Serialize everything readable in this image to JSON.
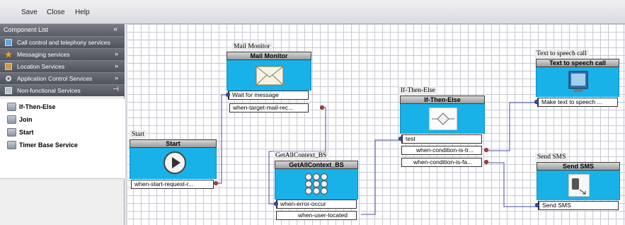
{
  "menu": {
    "save": "Save",
    "close": "Close",
    "help": "Help"
  },
  "sidebar": {
    "header": "Component List",
    "header_chevron": "«",
    "categories": [
      {
        "label": "Call control and telephony services",
        "chevron": ""
      },
      {
        "label": "Messaging services",
        "chevron": "»"
      },
      {
        "label": "Location Services",
        "chevron": "»"
      },
      {
        "label": "Application Control Services",
        "chevron": "»"
      },
      {
        "label": "Non-functional Services",
        "chevron": "⊣"
      }
    ],
    "components": [
      "If-Then-Else",
      "Join",
      "Start",
      "Timer Base Service"
    ]
  },
  "nodes": {
    "start": {
      "caption": "Start",
      "title": "Start",
      "outputs": [
        "when-start-request-r..."
      ]
    },
    "mail": {
      "caption": "Mail Monitor",
      "title": "Mail Monitor",
      "input": "Wait for message",
      "outputs": [
        "when-target-mail-rec..."
      ]
    },
    "getall": {
      "caption": "GetAllContext_BS",
      "title": "GetAllContext_BS",
      "input": "when-error-occur",
      "outputs": [
        "when-user-located"
      ]
    },
    "ifthen": {
      "caption": "If-Then-Else",
      "title": "If-Then-Else",
      "input": "test",
      "outputs": [
        "when-condition-is-tr...",
        "when-condition-is-fa..."
      ]
    },
    "tts": {
      "caption": "Text to speech call",
      "title": "Text to speech call",
      "input": "Make text to speech ..."
    },
    "sms": {
      "caption": "Send SMS",
      "title": "Send SMS",
      "input": "Send SMS"
    }
  },
  "colors": {
    "node_body": "#18b1e8",
    "link": "#4b4f9e",
    "out_port": "#b04040",
    "in_port": "#3c4fa8"
  }
}
